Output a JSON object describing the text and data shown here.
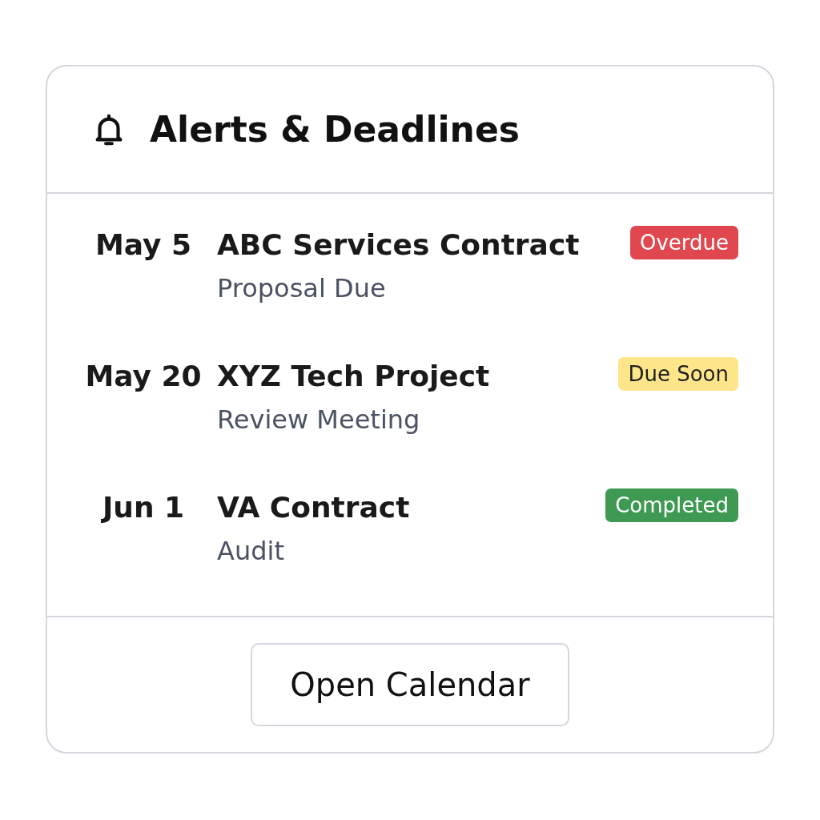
{
  "card": {
    "title": "Alerts & Deadlines"
  },
  "alerts": [
    {
      "date": "May 5",
      "title": "ABC Services Contract",
      "subtitle": "Proposal Due",
      "status": {
        "label": "Overdue",
        "kind": "overdue"
      }
    },
    {
      "date": "May 20",
      "title": "XYZ Tech Project",
      "subtitle": "Review Meeting",
      "status": {
        "label": "Due Soon",
        "kind": "due_soon"
      }
    },
    {
      "date": "Jun 1",
      "title": "VA Contract",
      "subtitle": "Audit",
      "status": {
        "label": "Completed",
        "kind": "completed"
      }
    }
  ],
  "footer": {
    "button": "Open Calendar"
  }
}
